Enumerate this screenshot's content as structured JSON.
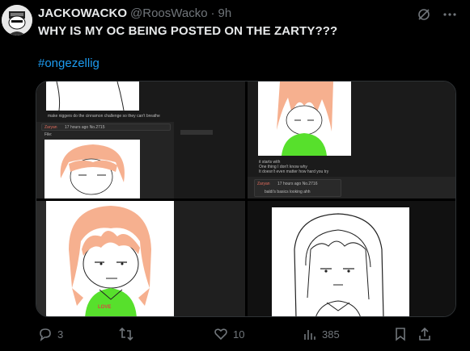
{
  "user": {
    "display_name": "JACKOWACKO",
    "handle": "@RoosWacko",
    "separator": "·",
    "time": "9h"
  },
  "tweet": {
    "text": "WHY IS MY OC BEING POSTED ON THE ZARTY???",
    "hashtag": "#ongezellig"
  },
  "media": {
    "cell1": {
      "caption": "make niggers do the cinnamon challenge so they can't breathe",
      "post_name": "Zaryan",
      "post_meta": "17 hours ago No.2715",
      "file_line": "File:"
    },
    "cell2": {
      "line1": "it starts with",
      "line2": "One thing I don't know why",
      "line3": "It doesn't even matter how hard you try",
      "post_name": "Zaryan",
      "post_meta": "17 hours ago No.2716",
      "reply": "baldi's basics looking ahh"
    },
    "cell3": {
      "shirt_text": "LOVE"
    }
  },
  "actions": {
    "replies": "3",
    "reposts": "",
    "likes": "10",
    "views": "385"
  },
  "colors": {
    "background": "#000000",
    "accent": "#1d9bf0",
    "muted": "#71767b",
    "text": "#e7e9ea",
    "shirt_green": "#57e02c",
    "hair": "#f6b08f"
  }
}
